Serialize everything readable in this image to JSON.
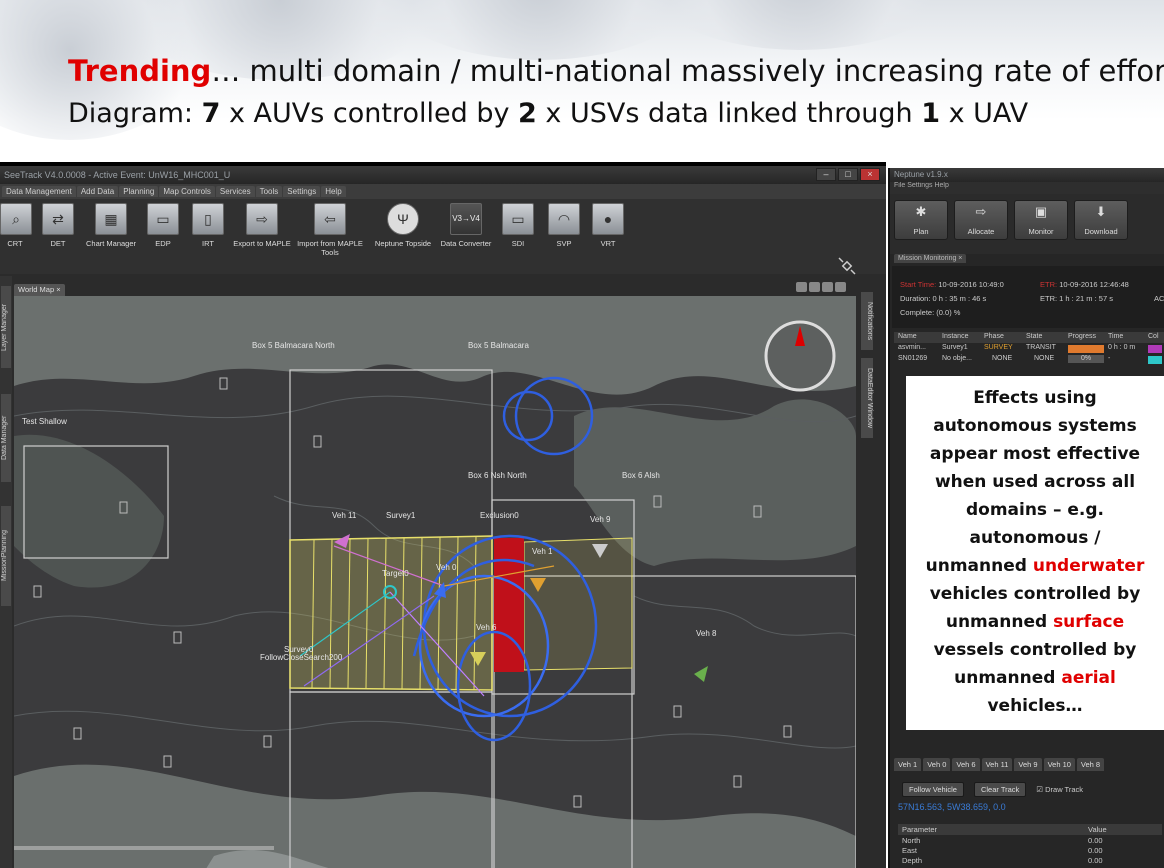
{
  "slide": {
    "line1": {
      "trending": "Trending",
      "rest": "… multi domain / multi-national massively increasing rate of effort…"
    },
    "line2": {
      "pre": "Diagram:  ",
      "n1": "7",
      "mid1": " x AUVs controlled by ",
      "n2": "2",
      "mid2": " x USVs data linked through ",
      "n3": "1",
      "post": " x UAV"
    }
  },
  "seetrack": {
    "title": "SeeTrack V4.0.0008 - Active Event: UnW16_MHC001_U",
    "menu": [
      "Data Management",
      "Add Data",
      "Planning",
      "Map Controls",
      "Services",
      "Tools",
      "Settings",
      "Help"
    ],
    "tools": [
      {
        "label": "CRT",
        "icon": "search-icon"
      },
      {
        "label": "DET",
        "icon": "arrows-icon"
      },
      {
        "label": "Chart Manager",
        "icon": "chart-icon"
      },
      {
        "label": "EDP",
        "icon": "panel-icon"
      },
      {
        "label": "IRT",
        "icon": "panel-icon"
      },
      {
        "label": "Export to MAPLE",
        "icon": "export-icon"
      },
      {
        "label": "Import from MAPLE Tools",
        "icon": "import-icon"
      },
      {
        "label": "Neptune Topside",
        "icon": "trident-icon"
      },
      {
        "label": "Data Converter",
        "icon": "converter-icon"
      },
      {
        "label": "SDI",
        "icon": "panel-icon"
      },
      {
        "label": "SVP",
        "icon": "sonar-icon"
      },
      {
        "label": "VRT",
        "icon": "sphere-icon"
      }
    ],
    "left_tabs": [
      "Layer Manager",
      "Data Manager",
      "MissionPlanning"
    ],
    "right_tabs": [
      "Notifications",
      "DataEditor Window"
    ],
    "map_tab": "World Map",
    "map_labels": {
      "box5_north": "Box 5 Balmacara North",
      "box5": "Box 5 Balmacara",
      "test_shallow": "Test Shallow",
      "box6_north": "Box 6 Nsh North",
      "box6": "Box 6 Alsh",
      "veh11": "Veh 11",
      "survey1": "Survey1",
      "exclusion0": "Exclusion0",
      "veh9": "Veh 9",
      "veh1": "Veh 1",
      "target0": "Target0",
      "veh0": "Veh 0",
      "veh6": "Veh 6",
      "veh8": "Veh 8",
      "survey0": "Survey0",
      "cluster": "FollowCloseSearch200"
    }
  },
  "neptune": {
    "title": "Neptune v1.9.x",
    "menu": "File  Settings  Help",
    "buttons": [
      "Plan",
      "Allocate",
      "Monitor",
      "Download"
    ],
    "mission_tab": "Mission Monitoring",
    "start_time_label": "Start Time:",
    "start_time": "10-09-2016 10:49:0",
    "etr_label": "ETR:",
    "etr_time": "10-09-2016 12:46:48",
    "duration": "Duration: 0 h : 35 m : 46 s",
    "etr": "ETR: 1 h : 21 m : 57 s",
    "complete": "Complete: (0.0) %",
    "extra": "AC",
    "table_headers": [
      "Name",
      "Instance",
      "Phase",
      "State",
      "Progress",
      "Time",
      "Col"
    ],
    "rows": [
      {
        "name": "asvmin...",
        "instance": "Survey1",
        "phase": "SURVEY",
        "state": "TRANSIT",
        "progress": 1.0,
        "time": "0 h : 0 m",
        "color": "#b03ab8"
      },
      {
        "name": "SN01269",
        "instance": "No obje...",
        "phase": "NONE",
        "state": "NONE",
        "progress_text": "0%",
        "progress": 0,
        "time": "-",
        "color": "#2ec7c9"
      }
    ],
    "vehicle_tabs": [
      "Veh 1",
      "Veh 0",
      "Veh 6",
      "Veh 11",
      "Veh 9",
      "Veh 10",
      "Veh 8"
    ],
    "follow_vehicle": "Follow Vehicle",
    "clear_track": "Clear Track",
    "draw_track": "Draw Track",
    "coords": "57N16.563, 5W38.659, 0.0",
    "param_headers": [
      "Parameter",
      "Value"
    ],
    "params": [
      {
        "name": "North",
        "value": "0.00"
      },
      {
        "name": "East",
        "value": "0.00"
      },
      {
        "name": "Depth",
        "value": "0.00"
      }
    ]
  },
  "callout": {
    "l1": "Effects using",
    "l2": "autonomous systems",
    "l3": "appear most effective",
    "l4": "when used  across all",
    "l5": "domains – e.g.",
    "l6": "autonomous /",
    "l7a": "unmanned ",
    "l7b": "underwater",
    "l8": "vehicles controlled by",
    "l9a": "unmanned ",
    "l9b": "surface",
    "l10": "vessels controlled by",
    "l11a": "unmanned ",
    "l11b": "aerial",
    "l12": "vehicles…"
  },
  "colors": {
    "accent_red": "#e00000",
    "track_blue": "#2f5fe0",
    "survey_yellow": "#e8e06a",
    "exclusion_red": "#c0101a"
  }
}
